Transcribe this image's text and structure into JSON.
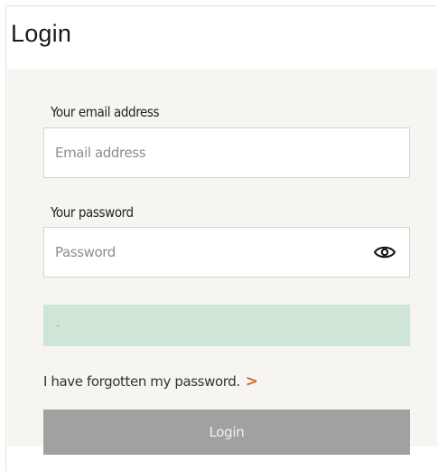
{
  "page": {
    "title": "Login"
  },
  "form": {
    "email_label": "Your email address",
    "email_placeholder": "Email address",
    "password_label": "Your password",
    "password_placeholder": "Password",
    "status_text": "-",
    "forgot_text": "I have forgotten my password.",
    "forgot_chevron": ">",
    "login_label": "Login"
  },
  "icons": {
    "password_toggle": "eye-icon",
    "forgot_link": "chevron-right-icon"
  },
  "colors": {
    "accent": "#d9652b",
    "status_background": "#cfe6d6",
    "button_background": "#a1a1a1",
    "panel_background": "#f7f5f2"
  }
}
